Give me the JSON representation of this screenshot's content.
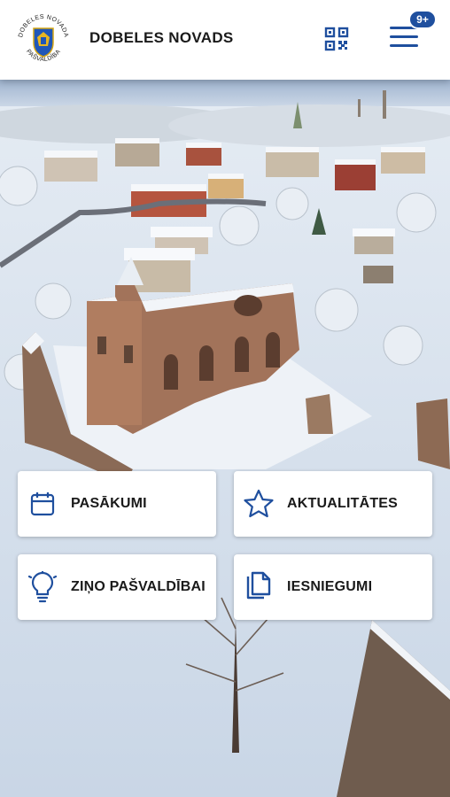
{
  "header": {
    "logo_text_top": "DOBELES NOVADA",
    "logo_text_bottom": "PAŠVALDĪBA",
    "title": "DOBELES NOVADS",
    "qr_icon": "qr-code-icon",
    "menu_icon": "hamburger-menu-icon",
    "notification_badge": "9+"
  },
  "hero": {
    "image": "snowy castle ruins aerial view"
  },
  "tiles": [
    {
      "label": "PASĀKUMI",
      "icon": "calendar-icon"
    },
    {
      "label": "AKTUALITĀTES",
      "icon": "star-icon"
    },
    {
      "label": "ZIŅO PAŠVALDĪBAI",
      "icon": "lightbulb-icon"
    },
    {
      "label": "IESNIEGUMI",
      "icon": "documents-icon"
    }
  ],
  "colors": {
    "accent": "#1f4f9e",
    "header_bg": "#ffffff",
    "tile_bg": "#ffffff"
  }
}
